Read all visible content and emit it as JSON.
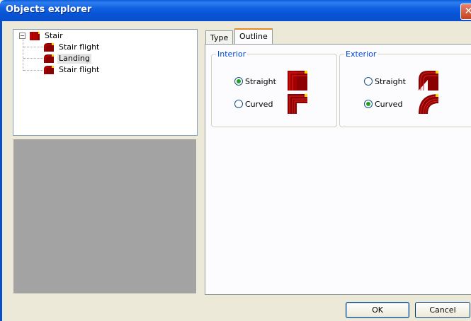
{
  "window": {
    "title": "Objects explorer",
    "close_glyph": "✕"
  },
  "tree": {
    "root": {
      "label": "Stair",
      "icon": "stair-icon",
      "expander": "−"
    },
    "children": [
      {
        "label": "Stair flight",
        "icon": "stair-flight-icon",
        "selected": false
      },
      {
        "label": "Landing",
        "icon": "landing-icon",
        "selected": true
      },
      {
        "label": "Stair flight",
        "icon": "stair-flight-icon",
        "selected": false
      }
    ]
  },
  "tabs": [
    {
      "label": "Type",
      "active": false
    },
    {
      "label": "Outline",
      "active": true
    }
  ],
  "interior": {
    "title": "Interior",
    "options": [
      {
        "label": "Straight",
        "checked": true,
        "icon": "straight-corner-icon"
      },
      {
        "label": "Curved",
        "checked": false,
        "icon": "straight-corner-icon"
      }
    ]
  },
  "exterior": {
    "title": "Exterior",
    "options": [
      {
        "label": "Straight",
        "checked": false,
        "icon": "curved-corner-icon"
      },
      {
        "label": "Curved",
        "checked": true,
        "icon": "curved-corner-icon"
      }
    ]
  },
  "buttons": {
    "ok": "OK",
    "cancel": "Cancel"
  },
  "colors": {
    "accent": "#e68b2c",
    "group_title": "#0046d5",
    "radio_check": "#21a121",
    "shape": "#8b0000",
    "preview": "#a3a3a3"
  }
}
